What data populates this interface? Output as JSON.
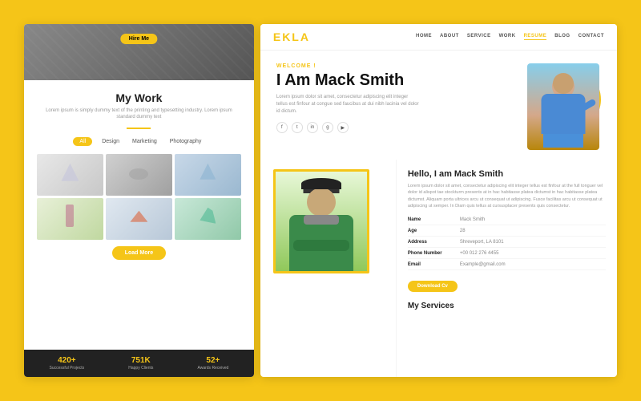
{
  "left": {
    "hero_btn": "Hire Me",
    "section_title": "My Work",
    "section_subtitle": "Lorem ipsum is simply dummy text of the printing and typesetting industry. Lorem ipsum standard dummy text",
    "filter_tabs": [
      "All",
      "Design",
      "Marketing",
      "Photography"
    ],
    "active_tab": "All",
    "load_more": "Load More",
    "stats": [
      {
        "number": "420+",
        "label": "Successful Projects"
      },
      {
        "number": "751K",
        "label": "Happy Clients"
      },
      {
        "number": "52+",
        "label": "Awards Received"
      }
    ]
  },
  "right": {
    "brand": "EKLA",
    "nav": [
      "HOME",
      "ABOUT",
      "SERVICE",
      "WORK",
      "RESUME",
      "BLOG",
      "CONTACT"
    ],
    "active_nav": "RESUME",
    "welcome_label": "WELCOME !",
    "hero_name": "I Am Mack Smith",
    "hero_desc": "Lorem ipsum dolor sit amet, consectetur adipiscing elit integer tellus est finfour at congue sed faucibus at dui nibh lacinia vel dolor id dictum.",
    "social_icons": [
      "f",
      "t",
      "in",
      "g+",
      "yt"
    ],
    "about_title": "Hello, I am Mack Smith",
    "about_desc": "Lorem ipsum dolor sit amet, consectetur adipiscing elit integer tellus est finfour at the full tonguer vel dolor id alispot tae stockturm presents at in hac habitasse platea dictumst in hac habitasse platea dictumst. Aliquam porta ultrices arcu ut consequat ut adipiscing. Fusce facilitas arcu ut consequat ut adipiscing ut semper. In Diam quis tellus at cursusplacer presents quis consectetur.",
    "info": [
      {
        "label": "Name",
        "value": "Mack Smith"
      },
      {
        "label": "Age",
        "value": "28"
      },
      {
        "label": "Address",
        "value": "Shreveport, LA 8101"
      },
      {
        "label": "Phone Number",
        "value": "+00 012 276 4455"
      },
      {
        "label": "Email",
        "value": "Example@gmail.com"
      }
    ],
    "download_btn": "Download Cv",
    "services_label": "My Services"
  }
}
